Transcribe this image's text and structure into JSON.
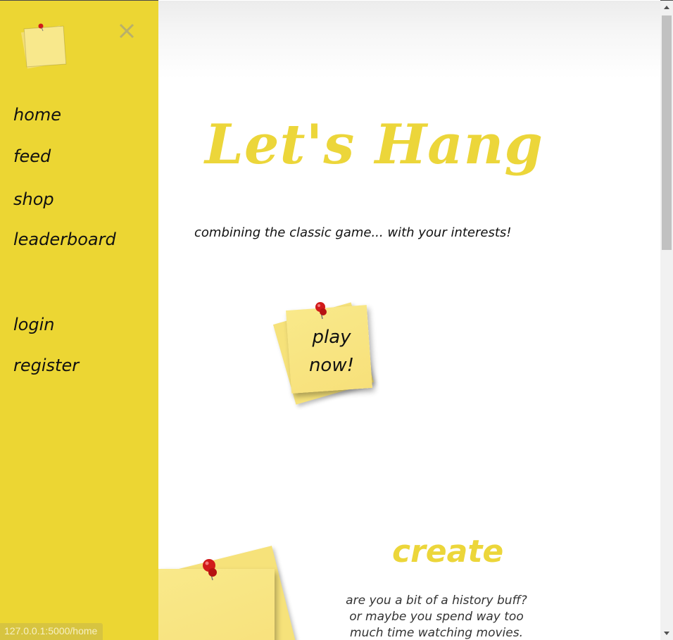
{
  "sidebar": {
    "close_symbol": "✕",
    "nav": {
      "home": "home",
      "feed": "feed",
      "shop": "shop",
      "leaderboard": "leaderboard",
      "login": "login",
      "register": "register"
    }
  },
  "hero": {
    "title": "Let's Hang",
    "tagline": "combining the classic game... with your interests!",
    "play_button_line1": "play",
    "play_button_line2": "now!"
  },
  "create": {
    "title": "create",
    "text_line1": "are you a bit of a history buff?",
    "text_line2": "or maybe you spend way too",
    "text_line3": "much time watching movies."
  },
  "status_bar": {
    "url": "127.0.0.1:5000/home"
  },
  "colors": {
    "accent_yellow": "#ecd633",
    "title_yellow": "#ecd63a",
    "note_yellow": "#f7e07a",
    "pin_red": "#d11a1a"
  },
  "icons": [
    "sticky-note-logo-icon",
    "close-icon",
    "pushpin-icon",
    "scroll-up-arrow-icon",
    "scroll-down-arrow-icon"
  ]
}
